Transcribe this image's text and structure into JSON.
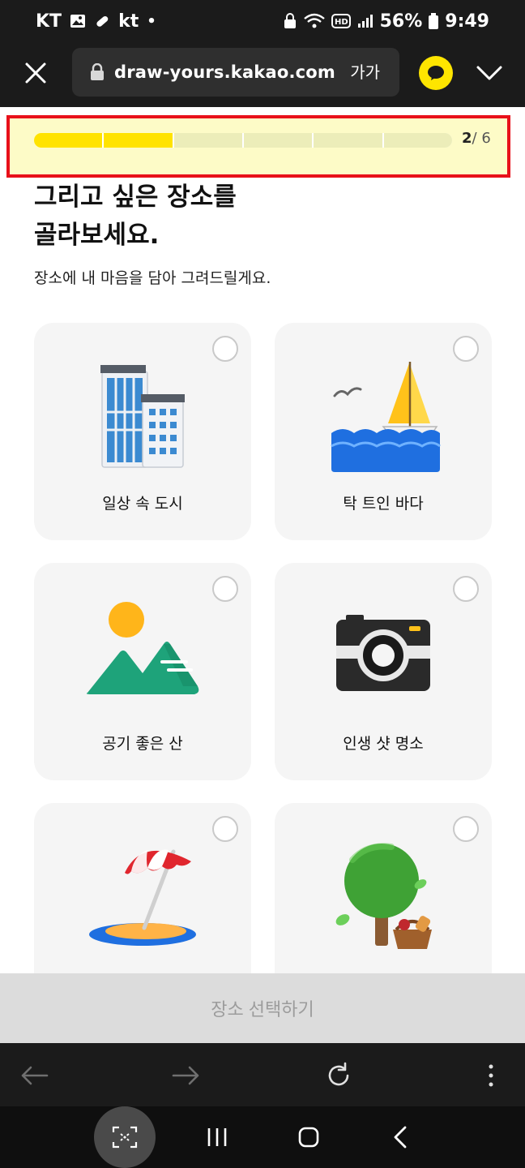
{
  "status_bar": {
    "carrier": "KT",
    "carrier2": "kt",
    "battery": "56%",
    "time": "9:49"
  },
  "browser": {
    "url": "draw-yours.kakao.com",
    "text_size_label": "가가"
  },
  "progress": {
    "current": "2",
    "total": "/ 6",
    "steps_total": 6,
    "steps_done": 2
  },
  "heading": {
    "title": "그리고 싶은 장소를\n골라보세요.",
    "subtitle": "장소에 내 마음을 담아 그려드릴게요."
  },
  "places": [
    {
      "label": "일상 속 도시",
      "icon": "city-buildings-icon"
    },
    {
      "label": "탁 트인 바다",
      "icon": "sea-sailboat-icon"
    },
    {
      "label": "공기 좋은 산",
      "icon": "mountain-sun-icon"
    },
    {
      "label": "인생 샷 명소",
      "icon": "camera-icon"
    },
    {
      "label": "",
      "icon": "beach-umbrella-icon"
    },
    {
      "label": "",
      "icon": "tree-picnic-icon"
    }
  ],
  "select_button": {
    "label": "장소 선택하기"
  },
  "colors": {
    "accent": "#ffe300",
    "kakao_yellow": "#fee500",
    "highlight_border": "#e8101a",
    "dark_bar": "#1b1b1b"
  }
}
